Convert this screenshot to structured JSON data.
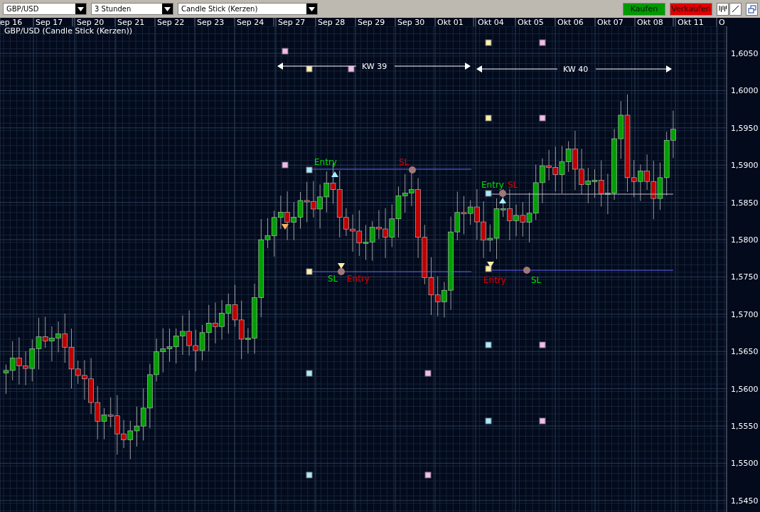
{
  "toolbar": {
    "dropdowns": [
      {
        "value": "GBP/USD"
      },
      {
        "value": "3 Stunden"
      },
      {
        "value": "Candle Stick (Kerzen)"
      }
    ],
    "buttons": [
      {
        "label": "Kaufen",
        "kind": "buy"
      },
      {
        "label": "Verkaufen",
        "kind": "sell"
      }
    ]
  },
  "date_axis": [
    "ep 16",
    "Sep 17",
    "Sep 20",
    "Sep 21",
    "Sep 22",
    "Sep 23",
    "Sep 24",
    "Sep 27",
    "Sep 28",
    "Sep 29",
    "Sep 30",
    "Okt 01",
    "Okt 04",
    "Okt 05",
    "Okt 06",
    "Okt 07",
    "Okt 08",
    "Okt 11",
    "O"
  ],
  "chart_title": "GBP/USD (Candle Stick (Kerzen))",
  "price_axis": [
    "1,6050",
    "1,6000",
    "1,5950",
    "1,5900",
    "1,5850",
    "1,5800",
    "1,5750",
    "1,5700",
    "1,5650",
    "1,5600",
    "1,5550",
    "1,5500",
    "1,5450"
  ],
  "week_ranges": [
    {
      "label": "KW 39"
    },
    {
      "label": "KW 40"
    }
  ],
  "trade_labels": [
    {
      "label": "Entry",
      "color": "#00e000"
    },
    {
      "label": "SL",
      "color": "#e00000"
    },
    {
      "label": "SL",
      "color": "#00e000"
    },
    {
      "label": "Entry",
      "color": "#e00000"
    },
    {
      "label": "Entry",
      "color": "#00e000"
    },
    {
      "label": "SL",
      "color": "#e00000"
    },
    {
      "label": "Entry",
      "color": "#e00000"
    },
    {
      "label": "SL",
      "color": "#00e000"
    }
  ]
}
